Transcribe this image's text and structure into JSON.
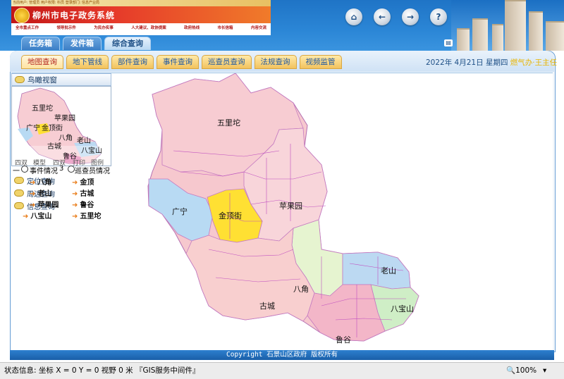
{
  "banner": {
    "top_text": "当前用户: 管理员  用户权限: 科员  登录部门: 信息产业局",
    "title": "柳州市电子政务系统",
    "nav": [
      "全市重点工作",
      "领导批示件",
      "为民办实事",
      "人大建议、政协提案",
      "政府热线",
      "市长信箱",
      "内容交流"
    ]
  },
  "toolbar": {
    "icons": [
      {
        "name": "home-icon",
        "glyph": "⌂"
      },
      {
        "name": "back-icon",
        "glyph": "←"
      },
      {
        "name": "forward-icon",
        "glyph": "→"
      },
      {
        "name": "help-icon",
        "glyph": "?"
      }
    ]
  },
  "main_tabs": [
    {
      "label": "任务箱",
      "active": false
    },
    {
      "label": "发件箱",
      "active": false
    },
    {
      "label": "综合查询",
      "active": true
    }
  ],
  "sub_tabs": [
    {
      "label": "地图查询",
      "active": true
    },
    {
      "label": "地下管线",
      "active": false
    },
    {
      "label": "部件查询",
      "active": false
    },
    {
      "label": "事件查询",
      "active": false
    },
    {
      "label": "巡查员查询",
      "active": false
    },
    {
      "label": "法规查询",
      "active": false
    },
    {
      "label": "视频监管",
      "active": false
    }
  ],
  "date_info": {
    "date": "2022年 4月21日 星期四",
    "user": "燃气办·王主任"
  },
  "sidebar": {
    "overview_title": "鸟瞰视窗",
    "overview_labels": [
      "五里坨",
      "苹果园",
      "广宁",
      "金顶街",
      "八角",
      "老山",
      "古城",
      "八宝山",
      "鲁谷"
    ],
    "overview_bottom_labels": [
      "四双",
      "模型",
      "四双",
      "打印",
      "图例"
    ],
    "options": [
      "事件情况",
      "巡查员情况"
    ],
    "sections": [
      "定位查询",
      "周边查询",
      "信息查询"
    ],
    "nav_links": [
      "八角",
      "金顶",
      "老山",
      "古城",
      "苹果园",
      "鲁谷",
      "八宝山",
      "五里坨"
    ],
    "scale_labels": [
      "一",
      "3"
    ]
  },
  "map": {
    "labels": [
      "五里坨",
      "苹果园",
      "金顶街",
      "广宁",
      "老山",
      "八角",
      "古城",
      "八宝山",
      "鲁谷"
    ]
  },
  "footer": {
    "text": "Copyright 石景山区政府 版权所有"
  },
  "status": {
    "text": "状态信息: 坐标 X = 0 Y = 0 视野 0 米 『GIS服务中间件』",
    "zoom": "100%",
    "zoom_caret": "▾"
  }
}
